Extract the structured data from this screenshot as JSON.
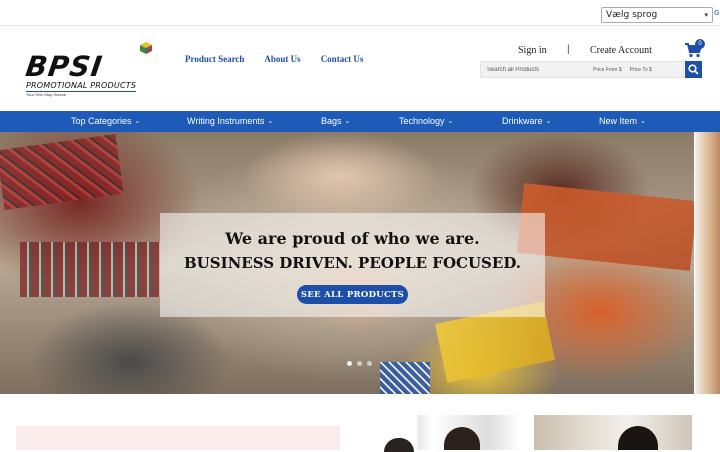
{
  "language": {
    "selected": "Vælg sprog",
    "g_mark": "G"
  },
  "brand": {
    "logo_text": "BPSI",
    "logo_subtitle": "PROMOTIONAL PRODUCTS",
    "logo_tagline": "Your One-Stop Source"
  },
  "nav": {
    "links": [
      "Product Search",
      "About Us",
      "Contact Us"
    ]
  },
  "account": {
    "sign_in": "Sign in",
    "separator": "|",
    "create": "Create Account",
    "cart_count": "0"
  },
  "search": {
    "placeholder": "Search all Products",
    "price_from": "Price From $",
    "price_to": "Price To $"
  },
  "categories": [
    "Top Categories",
    "Writing Instruments",
    "Bags",
    "Technology",
    "Drinkware",
    "New Item"
  ],
  "hero": {
    "line1": "We are proud of who we are.",
    "line2": "BUSINESS DRIVEN. PEOPLE FOCUSED.",
    "button": "SEE ALL PRODUCTS",
    "slides": 3,
    "active_slide": 1
  },
  "colors": {
    "brand_blue": "#1e4fa8",
    "category_bar": "#1e5bb8",
    "button": "#1e4fa8"
  }
}
